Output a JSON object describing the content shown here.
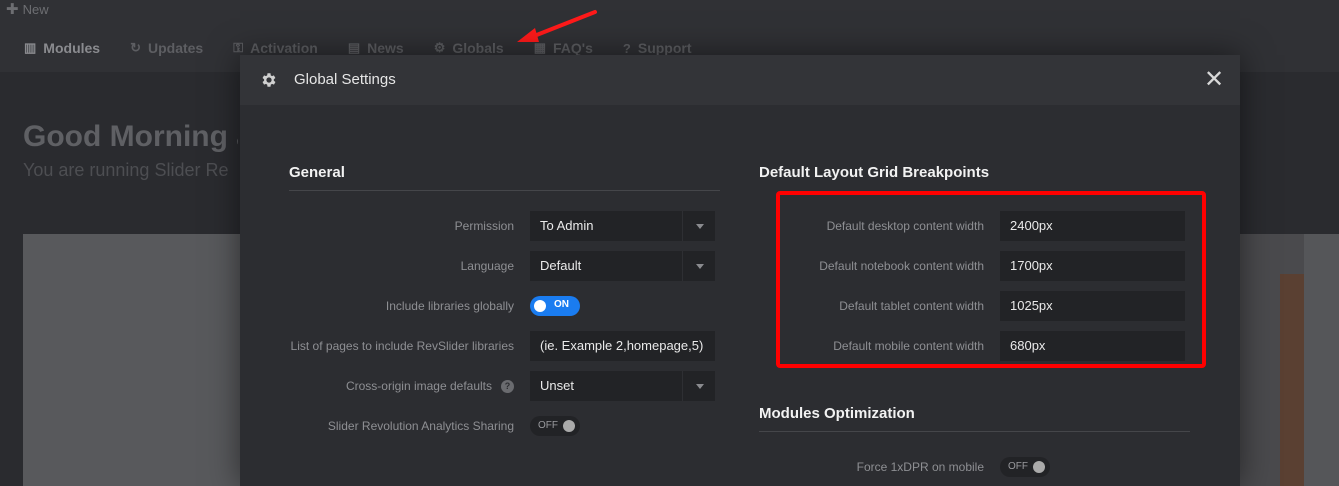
{
  "app": {
    "new_label": "New",
    "nav": [
      {
        "label": "Modules",
        "icon": "modules-icon"
      },
      {
        "label": "Updates",
        "icon": "updates-icon"
      },
      {
        "label": "Activation",
        "icon": "key-icon"
      },
      {
        "label": "News",
        "icon": "news-icon"
      },
      {
        "label": "Globals",
        "icon": "gear-icon"
      },
      {
        "label": "FAQ's",
        "icon": "faq-icon"
      },
      {
        "label": "Support",
        "icon": "support-icon"
      }
    ],
    "greeting": "Good Morning a",
    "subgreeting": "You are running Slider Re"
  },
  "modal": {
    "title": "Global Settings",
    "close_symbol": "✕",
    "general": {
      "title": "General",
      "permission_label": "Permission",
      "permission_value": "To Admin",
      "language_label": "Language",
      "language_value": "Default",
      "include_libraries_label": "Include libraries globally",
      "include_libraries_state": "ON",
      "pages_label": "List of pages to include RevSlider libraries",
      "pages_value": "(ie. Example 2,homepage,5)",
      "cross_origin_label": "Cross-origin image defaults",
      "cross_origin_help": "?",
      "cross_origin_value": "Unset",
      "analytics_label": "Slider Revolution Analytics Sharing",
      "analytics_state": "OFF"
    },
    "breakpoints": {
      "title": "Default Layout Grid Breakpoints",
      "desktop_label": "Default desktop content width",
      "desktop_value": "2400px",
      "notebook_label": "Default notebook content width",
      "notebook_value": "1700px",
      "tablet_label": "Default tablet content width",
      "tablet_value": "1025px",
      "mobile_label": "Default mobile content width",
      "mobile_value": "680px"
    },
    "optimization": {
      "title": "Modules Optimization",
      "force_dpr_label": "Force 1xDPR on mobile",
      "force_dpr_state": "OFF"
    }
  },
  "colors": {
    "accent": "#1a7cf0",
    "highlight": "#ff0000",
    "modal_bg": "#2c2d31"
  }
}
